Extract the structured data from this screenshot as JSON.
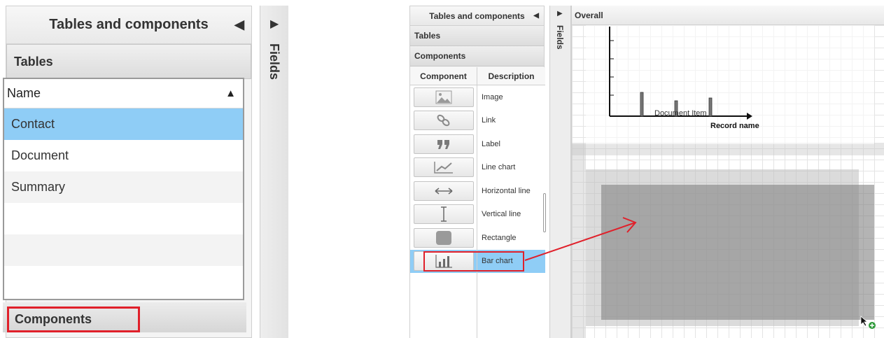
{
  "zoom_view": {
    "panel_title": "Tables and components",
    "tables_section": "Tables",
    "list_header": "Name",
    "items": [
      "Contact",
      "Document",
      "Summary"
    ],
    "selected_item": "Contact",
    "components_section": "Components",
    "side_panel": "Fields"
  },
  "full_view": {
    "panel_title": "Tables and components",
    "tables_section": "Tables",
    "components_section": "Components",
    "columns": {
      "component": "Component",
      "description": "Description"
    },
    "components": [
      {
        "icon": "image-icon",
        "description": "Image"
      },
      {
        "icon": "link-icon",
        "description": "Link"
      },
      {
        "icon": "quote-icon",
        "description": "Label"
      },
      {
        "icon": "line-chart-icon",
        "description": "Line chart"
      },
      {
        "icon": "horizontal-line-icon",
        "description": "Horizontal line"
      },
      {
        "icon": "vertical-line-icon",
        "description": "Vertical line"
      },
      {
        "icon": "rectangle-icon",
        "description": "Rectangle"
      },
      {
        "icon": "bar-chart-icon",
        "description": "Bar chart"
      }
    ],
    "selected_component": "Bar chart",
    "side_panel": "Fields",
    "canvas_tab": "Overall",
    "canvas_chart": {
      "x_axis_label": "Record name",
      "category_label": "Document Item"
    }
  },
  "colors": {
    "selection": "#8fcdf6",
    "highlight": "#e0202a",
    "drop_zone": "#8c8c8c"
  }
}
